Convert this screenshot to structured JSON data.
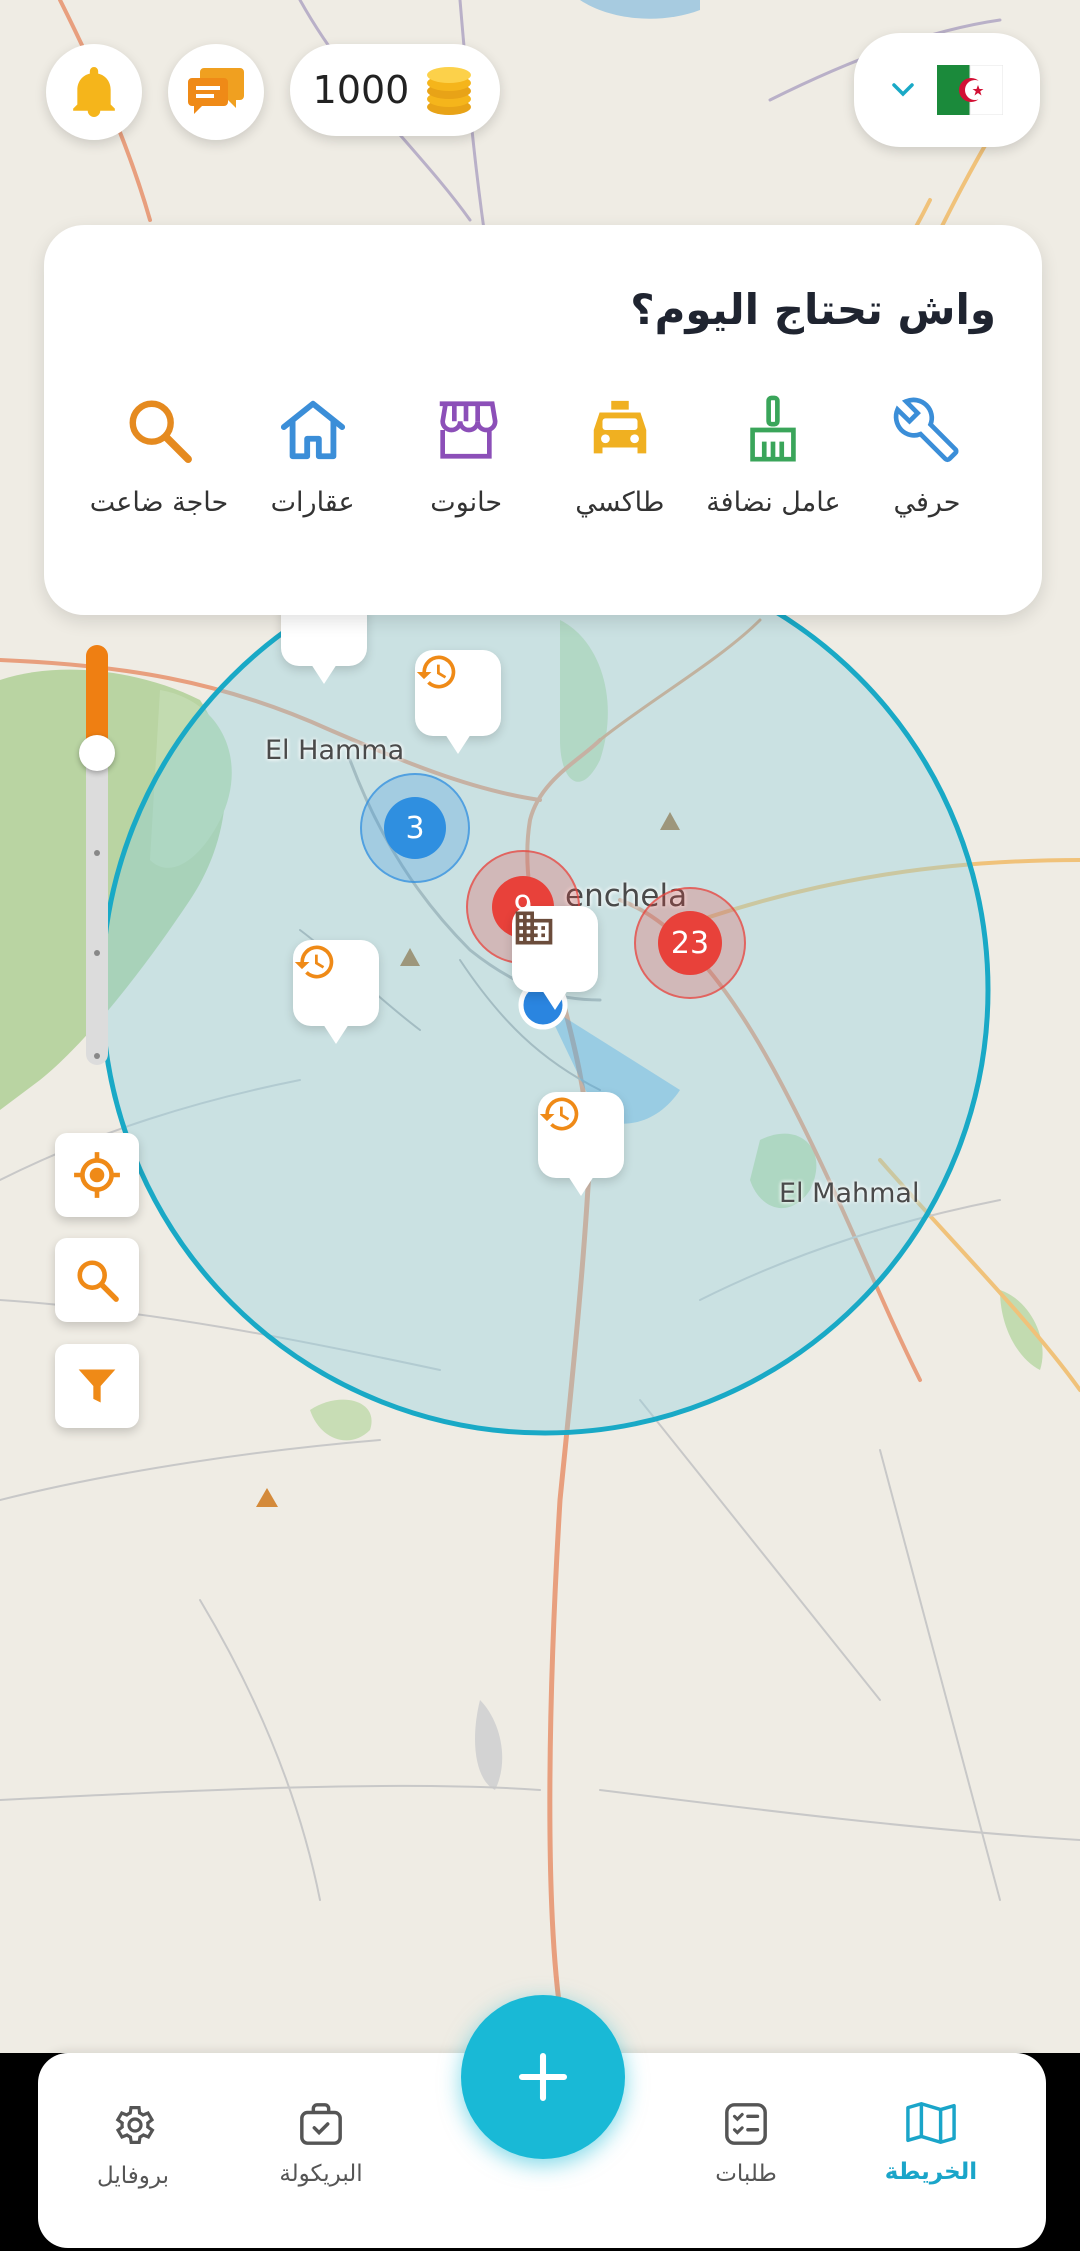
{
  "header": {
    "coins_value": "1000",
    "coins_icon": "coins-icon",
    "country_flag": "algeria-flag",
    "notification_icon": "bell-icon",
    "messages_icon": "chat-icon"
  },
  "panel": {
    "title": "واش تحتاج اليوم؟",
    "categories": [
      {
        "label": "حرفي",
        "icon": "wrench-icon",
        "color": "#3b8ed8"
      },
      {
        "label": "عامل نضافة",
        "icon": "broom-icon",
        "color": "#3aa55a"
      },
      {
        "label": "طاكسي",
        "icon": "taxi-icon",
        "color": "#f0b021"
      },
      {
        "label": "حانوت",
        "icon": "store-icon",
        "color": "#8c4fb8"
      },
      {
        "label": "عقارات",
        "icon": "house-icon",
        "color": "#3b8ed8"
      },
      {
        "label": "حاجة ضاعت",
        "icon": "search-icon",
        "color": "#e58a1f"
      }
    ]
  },
  "map": {
    "labels": {
      "el_hamma": "El Hamma",
      "khenchela": "enchela",
      "el_mahmal": "El Mahmal"
    },
    "clusters": [
      {
        "count": "3",
        "color": "#2f8fe0"
      },
      {
        "count": "9",
        "color": "#e8413a"
      },
      {
        "count": "23",
        "color": "#e8413a"
      }
    ],
    "zoom_level": 0.25,
    "accent_color": "#19b9d6"
  },
  "tools": {
    "locate_icon": "crosshair-icon",
    "search_icon": "search-icon",
    "filter_icon": "filter-icon"
  },
  "bottom_nav": {
    "items": [
      {
        "label": "الخريطة",
        "icon": "map-icon",
        "active": true
      },
      {
        "label": "طلبات",
        "icon": "checklist-icon",
        "active": false
      },
      {
        "label": "البريكولة",
        "icon": "briefcase-icon",
        "active": false
      },
      {
        "label": "بروفايل",
        "icon": "gear-icon",
        "active": false
      }
    ],
    "fab_icon": "plus-icon"
  }
}
